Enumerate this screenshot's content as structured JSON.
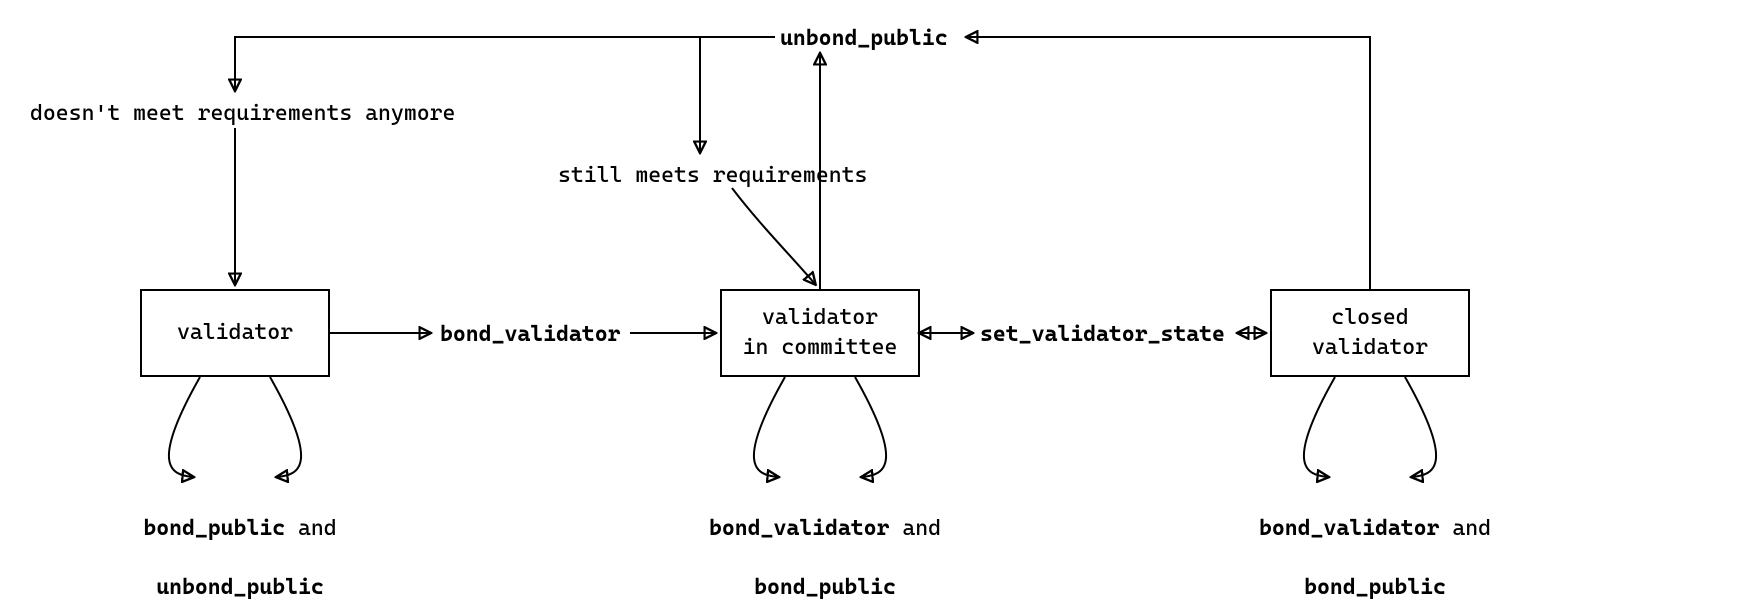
{
  "nodes": {
    "validator": "validator",
    "committee": "validator\nin committee",
    "closed": "closed\nvalidator"
  },
  "edges": {
    "unbond_top": "unbond_public",
    "no_req": "doesn't meet requirements anymore",
    "still_req": "still meets requirements",
    "bond_validator": "bond_validator",
    "set_state": "set_validator_state"
  },
  "selfloops": {
    "validator": {
      "line1a": "bond_public",
      "and": " and",
      "line2": "unbond_public"
    },
    "committee": {
      "line1a": "bond_validator",
      "and": " and",
      "line2": "bond_public"
    },
    "closed": {
      "line1a": "bond_validator",
      "and": " and",
      "line2": "bond_public"
    }
  }
}
